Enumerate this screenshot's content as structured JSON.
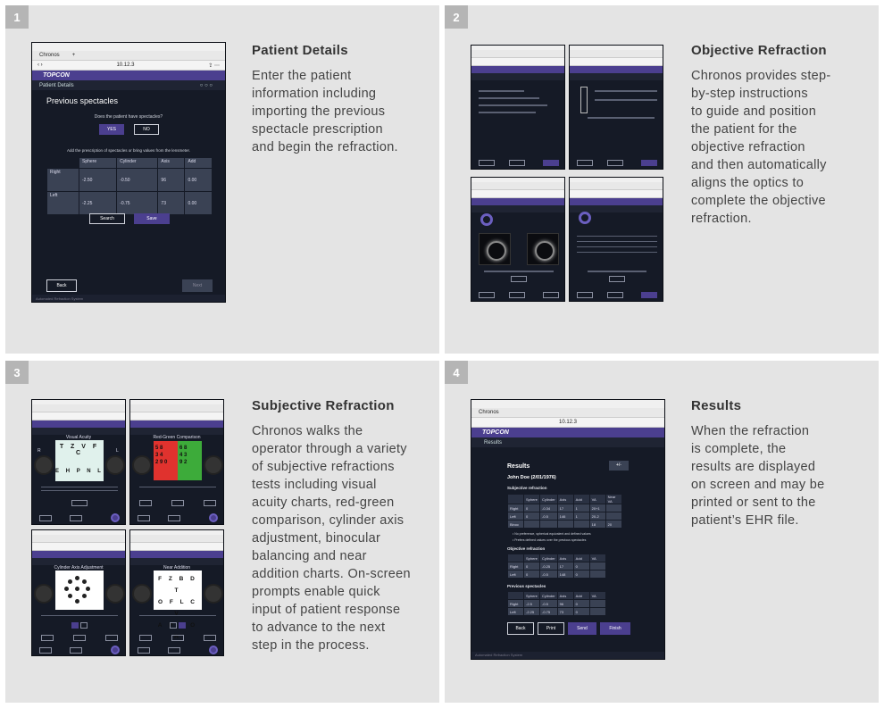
{
  "panels": [
    {
      "number": "1",
      "title": "Patient Details",
      "desc_lines": [
        "Enter the patient",
        "information including",
        "importing the previous",
        "spectacle prescription",
        "and begin the refraction."
      ]
    },
    {
      "number": "2",
      "title": "Objective Refraction",
      "desc_lines": [
        "Chronos provides step-",
        "by-step instructions",
        "to guide and position",
        "the patient for the",
        "objective refraction",
        "and then automatically",
        "aligns the optics to",
        "complete the objective",
        "refraction."
      ]
    },
    {
      "number": "3",
      "title": "Subjective Refraction",
      "desc_lines": [
        "Chronos walks the",
        "operator through a variety",
        "of subjective refractions",
        "tests including visual",
        "acuity charts, red-green",
        "comparison, cylinder axis",
        "adjustment, binocular",
        "balancing and near",
        "addition charts. On-screen",
        "prompts enable quick",
        "input of patient response",
        "to advance to the next",
        "step in the process."
      ]
    },
    {
      "number": "4",
      "title": "Results",
      "desc_lines": [
        "When the refraction",
        "is complete, the",
        "results are displayed",
        "on screen and may be",
        "printed or sent to the",
        "patient’s EHR file."
      ]
    }
  ],
  "screen1": {
    "tab_title": "Chronos",
    "url": "10.12.3",
    "brand": "TOPCON",
    "section": "Patient Details",
    "heading": "Previous spectacles",
    "question": "Does the patient have spectacles?",
    "yes": "YES",
    "no": "NO",
    "add_text": "Add the prescription of spectacles or bring values from the lensmeter.",
    "columns": [
      "Sphere",
      "Cylinder",
      "Axis",
      "Add"
    ],
    "rows": [
      {
        "label": "Right",
        "values": [
          "-2.50",
          "-0.50",
          "96",
          "0.00"
        ]
      },
      {
        "label": "Left",
        "values": [
          "-2.25",
          "-0.75",
          "73",
          "0.00"
        ]
      }
    ],
    "search": "Search",
    "save": "Save",
    "back": "Back",
    "next": "Next",
    "footer": "Automated Refraction System"
  },
  "screen3": {
    "va_title": "Visual Acuity",
    "va_line1": "T Z V F C",
    "va_line2": "E H P N L",
    "rg_title": "Red-Green Comparison",
    "rg_left": "5 8 / 3 4 / 2 9 0",
    "rg_right": "6 8 / 4 3 / 9 2",
    "cyl_title": "Cylinder Axis Adjustment",
    "near_title": "Near Addition",
    "near_line1": "F Z B D T",
    "near_line2": "O F L C V",
    "near_line3": "A P E O H",
    "r": "R",
    "l": "L"
  },
  "screen4": {
    "tab_title": "Chronos",
    "url": "10.12.3",
    "brand": "TOPCON",
    "section": "Results",
    "heading": "Results",
    "patient": "John Doe (2/01/1976)",
    "subjective_title": "Subjective refraction",
    "subjective_cols": [
      "",
      "Sphere",
      "Cylinder",
      "Axis",
      "Add",
      "VA",
      "Near VA"
    ],
    "subjective_rows": [
      [
        "Right",
        "0",
        "-0.34",
        "17",
        "1",
        "20+1",
        ""
      ],
      [
        "Left",
        "0",
        "-0.5",
        "146",
        "1",
        "20-2",
        ""
      ],
      [
        "Binoc",
        "",
        "",
        "",
        "",
        "18",
        "20"
      ]
    ],
    "note1": "No preference, spherical equivalent and defined values",
    "note2": "Prefers defined values over the previous spectacles",
    "objective_title": "Objective refraction",
    "objective_cols": [
      "",
      "Sphere",
      "Cylinder",
      "Axis",
      "Add",
      "VA"
    ],
    "objective_rows": [
      [
        "Right",
        "0",
        "-0.25",
        "17",
        "0",
        ""
      ],
      [
        "Left",
        "0",
        "-0.5",
        "148",
        "0",
        ""
      ]
    ],
    "previous_title": "Previous spectacles",
    "previous_cols": [
      "",
      "Sphere",
      "Cylinder",
      "Axis",
      "Add",
      "VA"
    ],
    "previous_rows": [
      [
        "Right",
        "-2.5",
        "-0.5",
        "96",
        "0",
        ""
      ],
      [
        "Left",
        "-2.25",
        "-0.75",
        "73",
        "0",
        ""
      ]
    ],
    "back": "Back",
    "print": "Print",
    "send": "Send",
    "finish": "Finish",
    "footer": "Automated Refraction System"
  },
  "colors": {
    "accent": "#4b3f8f",
    "screen_bg": "#151a26",
    "panel_bg": "#e4e4e4"
  }
}
